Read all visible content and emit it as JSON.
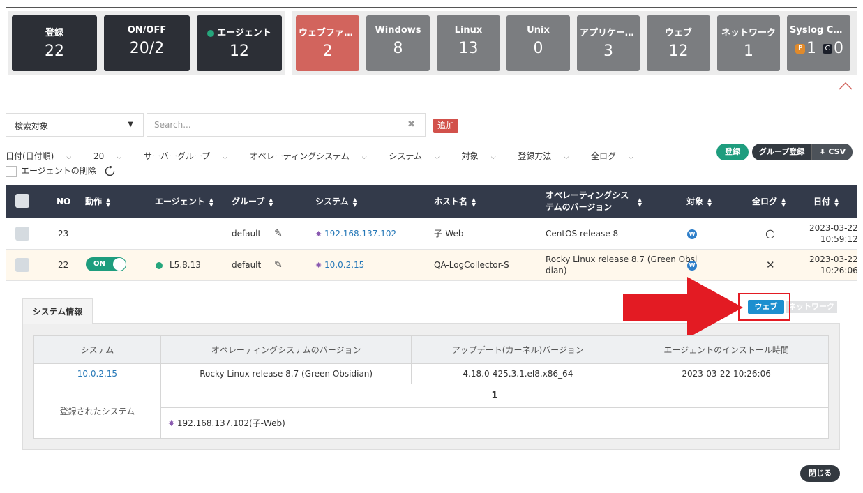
{
  "stats": [
    {
      "label": "登録",
      "value": "22"
    },
    {
      "label": "ON/OFF",
      "value": "20/2"
    },
    {
      "label": "エージェント",
      "value": "12"
    },
    {
      "label": "ウェブファイアウォール",
      "value": "2"
    },
    {
      "label": "Windows",
      "value": "8"
    },
    {
      "label": "Linux",
      "value": "13"
    },
    {
      "label": "Unix",
      "value": "0"
    },
    {
      "label": "アプリケーション",
      "value": "3"
    },
    {
      "label": "ウェブ",
      "value": "12"
    },
    {
      "label": "ネットワーク",
      "value": "1"
    },
    {
      "label": "Syslog Collector",
      "p_badge": "P",
      "p_value": "1",
      "c_badge": "C",
      "c_value": "0"
    }
  ],
  "search": {
    "selector": "検索対象",
    "placeholder": "Search...",
    "clear": "✖",
    "add": "追加"
  },
  "filters": [
    {
      "label": "日付(日付順)"
    },
    {
      "label": "20"
    },
    {
      "label": "サーバーグループ"
    },
    {
      "label": "オペレーティングシステム"
    },
    {
      "label": "システム"
    },
    {
      "label": "対象"
    },
    {
      "label": "登録方法"
    },
    {
      "label": "全ログ"
    }
  ],
  "delete_agent": "エージェントの削除",
  "actions": {
    "register": "登録",
    "group_register": "グループ登録",
    "csv": "CSV"
  },
  "columns": {
    "no": "NO",
    "action": "動作",
    "agent": "エージェント",
    "group": "グループ",
    "system": "システム",
    "host": "ホスト名",
    "os_version_1": "オペレーティングシス",
    "os_version_2": "テムのバージョン",
    "target": "対象",
    "full_log": "全ログ",
    "date": "日付"
  },
  "rows": [
    {
      "no": "23",
      "action": "-",
      "agent": "-",
      "group": "default",
      "system": "192.168.137.102",
      "host": "子-Web",
      "os": "CentOS release 8",
      "os2": "",
      "target": "W",
      "full_log": "○",
      "date": "2023-03-22",
      "time": "10:59:12"
    },
    {
      "no": "22",
      "toggle": "ON",
      "agent": "L5.8.13",
      "group": "default",
      "system": "10.0.2.15",
      "host": "QA-LogCollector-S",
      "os": "Rocky Linux release 8.7 (Green Obsi",
      "os2": "dian)",
      "target": "W",
      "full_log": "✕",
      "date": "2023-03-22",
      "time": "10:26:06"
    }
  ],
  "detail": {
    "tab": "システム情報",
    "type_buttons": {
      "web": "ウェブ",
      "network": "ネットワーク"
    },
    "headers": [
      "システム",
      "オペレーティングシステムのバージョン",
      "アップデート(カーネル)バージョン",
      "エージェントのインストール時間"
    ],
    "values": [
      "10.0.2.15",
      "Rocky Linux release 8.7 (Green Obsidian)",
      "4.18.0-425.3.1.el8.x86_64",
      "2023-03-22 10:26:06"
    ],
    "registered_label": "登録されたシステム",
    "registered_count": "1",
    "registered_item": "192.168.137.102(子-Web)"
  },
  "close": "閉じる",
  "colors": {
    "dark": "#2c2f36",
    "gray": "#7b7d80",
    "red": "#d2645d",
    "green": "#1e9d7e",
    "link": "#2779b8",
    "header": "#333a4a"
  }
}
